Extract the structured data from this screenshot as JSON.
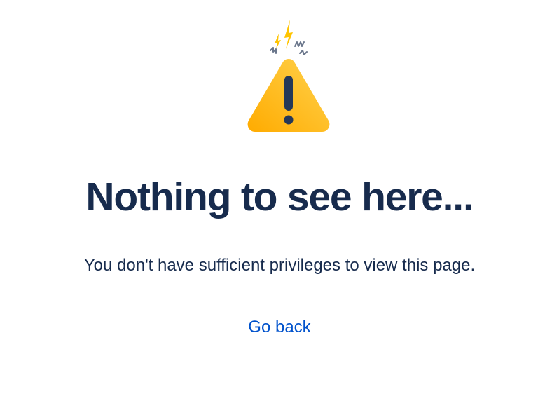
{
  "error": {
    "illustration_icon": "warning-triangle-icon",
    "title": "Nothing to see here...",
    "message": "You don't have sufficient privileges to view this page.",
    "back_link": "Go back"
  },
  "colors": {
    "heading": "#172b4d",
    "link": "#0052cc",
    "warning_fill": "#ffc400",
    "warning_dark": "#ffab00",
    "exclamation": "#253858",
    "spark_yellow": "#ffc400",
    "spark_gray": "#6b778c"
  }
}
